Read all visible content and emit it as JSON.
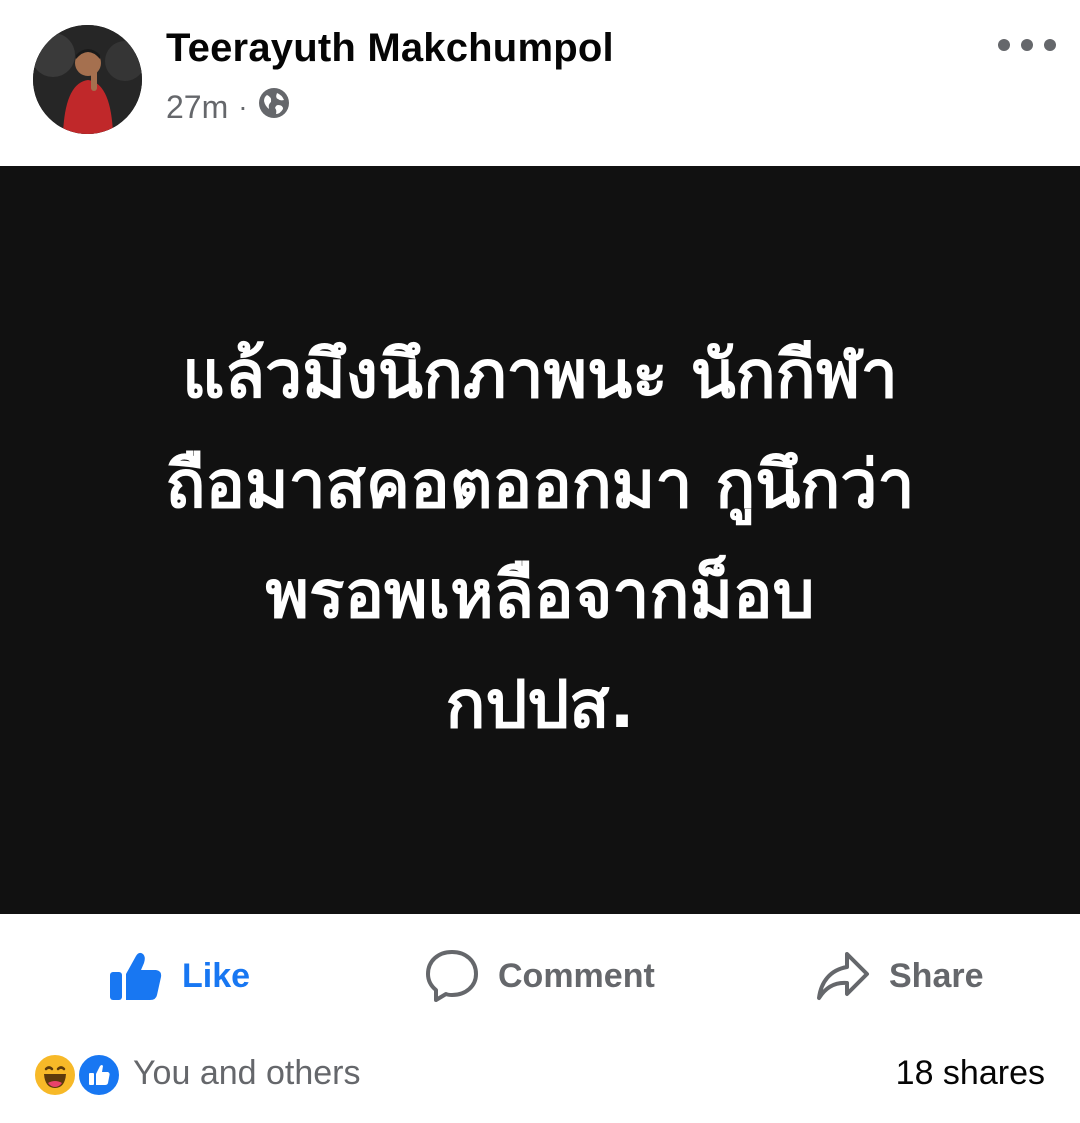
{
  "post": {
    "author": "Teerayuth Makchumpol",
    "time": "27m",
    "separator": "·",
    "privacy_icon": "globe-icon",
    "image_text": "แล้วมึงนึกภาพนะ นักกีฬา\nถือมาสคอตออกมา กูนึกว่า\nพรอพเหลือจากม็อบ\nกปปส."
  },
  "actions": {
    "like_label": "Like",
    "comment_label": "Comment",
    "share_label": "Share"
  },
  "footer": {
    "reactions_text": "You and others",
    "shares_text": "18 shares",
    "reaction_icons": [
      "haha-reaction-icon",
      "like-reaction-icon"
    ]
  },
  "colors": {
    "accent": "#1877f2",
    "secondary_text": "#65676b",
    "image_background": "#111111"
  }
}
